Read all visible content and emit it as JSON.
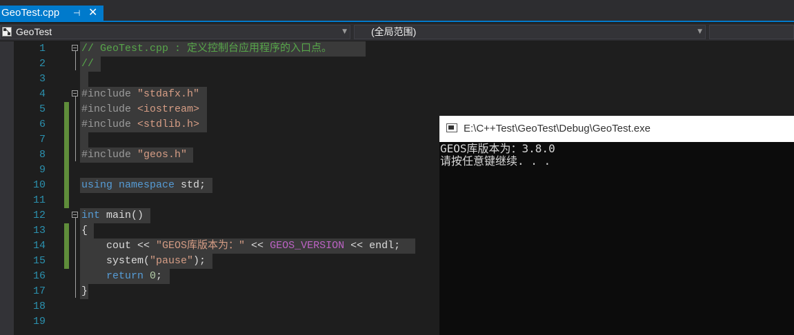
{
  "tab": {
    "filename": "GeoTest.cpp",
    "pin_glyph": "⊣",
    "close_glyph": "✕"
  },
  "navbar": {
    "project": "GeoTest",
    "scope": "(全局范围)"
  },
  "lines": [
    {
      "n": "1"
    },
    {
      "n": "2"
    },
    {
      "n": "3"
    },
    {
      "n": "4"
    },
    {
      "n": "5"
    },
    {
      "n": "6"
    },
    {
      "n": "7"
    },
    {
      "n": "8"
    },
    {
      "n": "9"
    },
    {
      "n": "10"
    },
    {
      "n": "11"
    },
    {
      "n": "12"
    },
    {
      "n": "13"
    },
    {
      "n": "14"
    },
    {
      "n": "15"
    },
    {
      "n": "16"
    },
    {
      "n": "17"
    },
    {
      "n": "18"
    },
    {
      "n": "19"
    }
  ],
  "code": {
    "l1": "// GeoTest.cpp : 定义控制台应用程序的入口点。",
    "l2": "//",
    "l4_pre": "#include ",
    "l4_str": "\"stdafx.h\"",
    "l5_pre": "#include ",
    "l5_str": "<iostream>",
    "l6_pre": "#include ",
    "l6_str": "<stdlib.h>",
    "l8_pre": "#include ",
    "l8_str": "\"geos.h\"",
    "l10_kw1": "using",
    "l10_kw2": "namespace",
    "l10_rest": " std;",
    "l12_kw": "int",
    "l12_rest": " main()",
    "l13": "{",
    "l14_a": "    cout << ",
    "l14_str": "\"GEOS库版本为：\"",
    "l14_b": " << ",
    "l14_mac": "GEOS_VERSION",
    "l14_c": " << endl;",
    "l15_a": "    system(",
    "l15_str": "\"pause\"",
    "l15_b": ");",
    "l16_kw": "    return",
    "l16_sp": " ",
    "l16_num": "0",
    "l16_end": ";",
    "l17": "}"
  },
  "console": {
    "title": "E:\\C++Test\\GeoTest\\Debug\\GeoTest.exe",
    "output_line1": "GEOS库版本为：3.8.0",
    "output_line2": "请按任意键继续. . ."
  }
}
